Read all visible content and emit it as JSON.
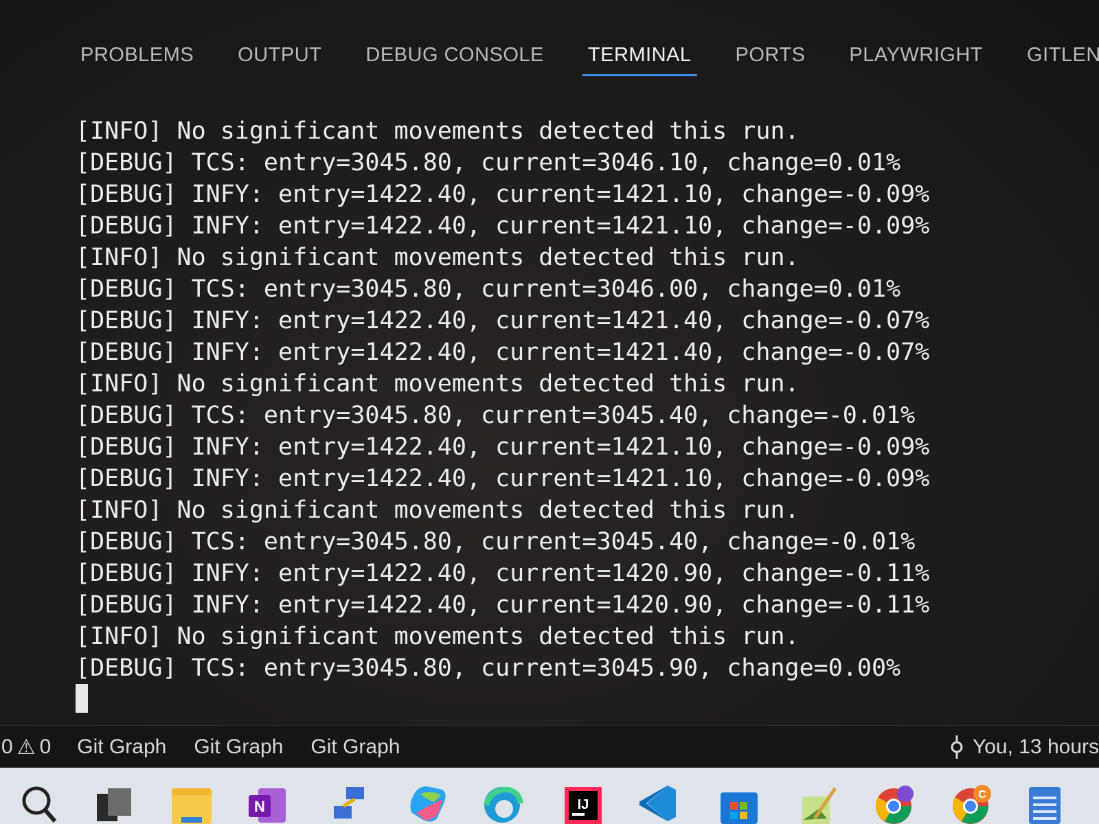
{
  "panel": {
    "tabs": [
      {
        "label": "PROBLEMS"
      },
      {
        "label": "OUTPUT"
      },
      {
        "label": "DEBUG CONSOLE"
      },
      {
        "label": "TERMINAL",
        "active": true
      },
      {
        "label": "PORTS"
      },
      {
        "label": "PLAYWRIGHT"
      },
      {
        "label": "GITLENS"
      }
    ]
  },
  "terminal": {
    "lines": [
      "[INFO] No significant movements detected this run.",
      "[DEBUG] TCS: entry=3045.80, current=3046.10, change=0.01%",
      "[DEBUG] INFY: entry=1422.40, current=1421.10, change=-0.09%",
      "[DEBUG] INFY: entry=1422.40, current=1421.10, change=-0.09%",
      "[INFO] No significant movements detected this run.",
      "[DEBUG] TCS: entry=3045.80, current=3046.00, change=0.01%",
      "[DEBUG] INFY: entry=1422.40, current=1421.40, change=-0.07%",
      "[DEBUG] INFY: entry=1422.40, current=1421.40, change=-0.07%",
      "[INFO] No significant movements detected this run.",
      "[DEBUG] TCS: entry=3045.80, current=3045.40, change=-0.01%",
      "[DEBUG] INFY: entry=1422.40, current=1421.10, change=-0.09%",
      "[DEBUG] INFY: entry=1422.40, current=1421.10, change=-0.09%",
      "[INFO] No significant movements detected this run.",
      "[DEBUG] TCS: entry=3045.80, current=3045.40, change=-0.01%",
      "[DEBUG] INFY: entry=1422.40, current=1420.90, change=-0.11%",
      "[DEBUG] INFY: entry=1422.40, current=1420.90, change=-0.11%",
      "[INFO] No significant movements detected this run.",
      "[DEBUG] TCS: entry=3045.80, current=3045.90, change=0.00%"
    ]
  },
  "status_bar": {
    "errors_count": "0",
    "warnings_count": "0",
    "warning_icon": "warning-icon",
    "git_graph_1": "Git Graph",
    "git_graph_2": "Git Graph",
    "git_graph_3": "Git Graph",
    "blame_text": "You, 13 hours",
    "blame_icon": "git-commit-icon"
  },
  "taskbar": {
    "icons": [
      "search-icon",
      "task-view-icon",
      "file-explorer-icon",
      "onenote-icon",
      "network-icon",
      "copilot-icon",
      "edge-icon",
      "intellij-icon",
      "vscode-icon",
      "microsoft-store-icon",
      "notepad-edit-icon",
      "chrome-icon",
      "chrome-canary-icon",
      "notepad-icon"
    ]
  },
  "colors": {
    "accent": "#3b8eea",
    "terminal_text": "#ececec",
    "tab_inactive": "#b9b9b9",
    "taskbar_bg": "#dfe3ea"
  }
}
